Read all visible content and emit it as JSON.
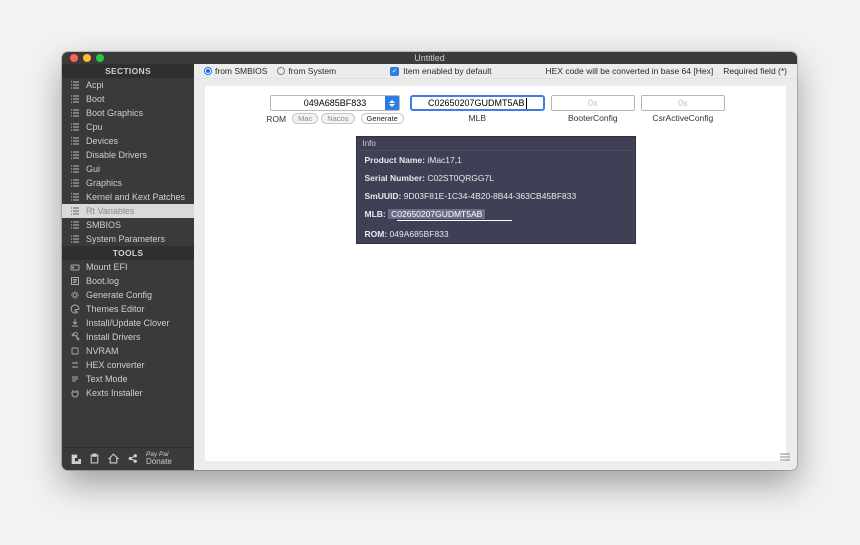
{
  "window": {
    "title": "Untitled"
  },
  "sidebar": {
    "sections_header": "SECTIONS",
    "tools_header": "TOOLS",
    "sections": [
      {
        "label": "Acpi"
      },
      {
        "label": "Boot"
      },
      {
        "label": "Boot Graphics"
      },
      {
        "label": "Cpu"
      },
      {
        "label": "Devices"
      },
      {
        "label": "Disable Drivers"
      },
      {
        "label": "Gui"
      },
      {
        "label": "Graphics"
      },
      {
        "label": "Kernel and Kext Patches"
      },
      {
        "label": "Rt Variables"
      },
      {
        "label": "SMBIOS"
      },
      {
        "label": "System Parameters"
      }
    ],
    "tools": [
      {
        "label": "Mount EFI"
      },
      {
        "label": "Boot.log"
      },
      {
        "label": "Generate Config"
      },
      {
        "label": "Themes Editor"
      },
      {
        "label": "Install/Update Clover"
      },
      {
        "label": "Install Drivers"
      },
      {
        "label": "NVRAM"
      },
      {
        "label": "HEX converter"
      },
      {
        "label": "Text Mode"
      },
      {
        "label": "Kexts Installer"
      }
    ],
    "footer_donate": "Donate",
    "footer_paypal": "Pay Pal"
  },
  "topbar": {
    "from_smbios": "from SMBIOS",
    "from_system": "from System",
    "item_enabled": "Item enabled by default",
    "hex_note": "HEX code will be converted in base 64 [Hex]",
    "required": "Required field (*)"
  },
  "fields": {
    "rom_value": "049A685BF833",
    "rom_label": "ROM",
    "mac_btn": "Mac",
    "nacos_btn": "Nacos",
    "generate_btn": "Generate",
    "mlb_value": "C02650207GUDMT5AB",
    "mlb_label": "MLB",
    "booter_placeholder": "0x",
    "booter_label": "BooterConfig",
    "csr_placeholder": "0x",
    "csr_label": "CsrActiveConfig"
  },
  "info": {
    "header": "Info",
    "product_name_k": "Product Name:",
    "product_name_v": "iMac17,1",
    "serial_k": "Serial Number:",
    "serial_v": "C02ST0QRGG7L",
    "smuuid_k": "SmUUID:",
    "smuuid_v": "9D03F81E-1C34-4B20-8B44-363CB45BF833",
    "mlb_k": "MLB:",
    "mlb_v": "C02650207GUDMT5AB",
    "rom_k": "ROM:",
    "rom_v": "049A685BF833"
  }
}
